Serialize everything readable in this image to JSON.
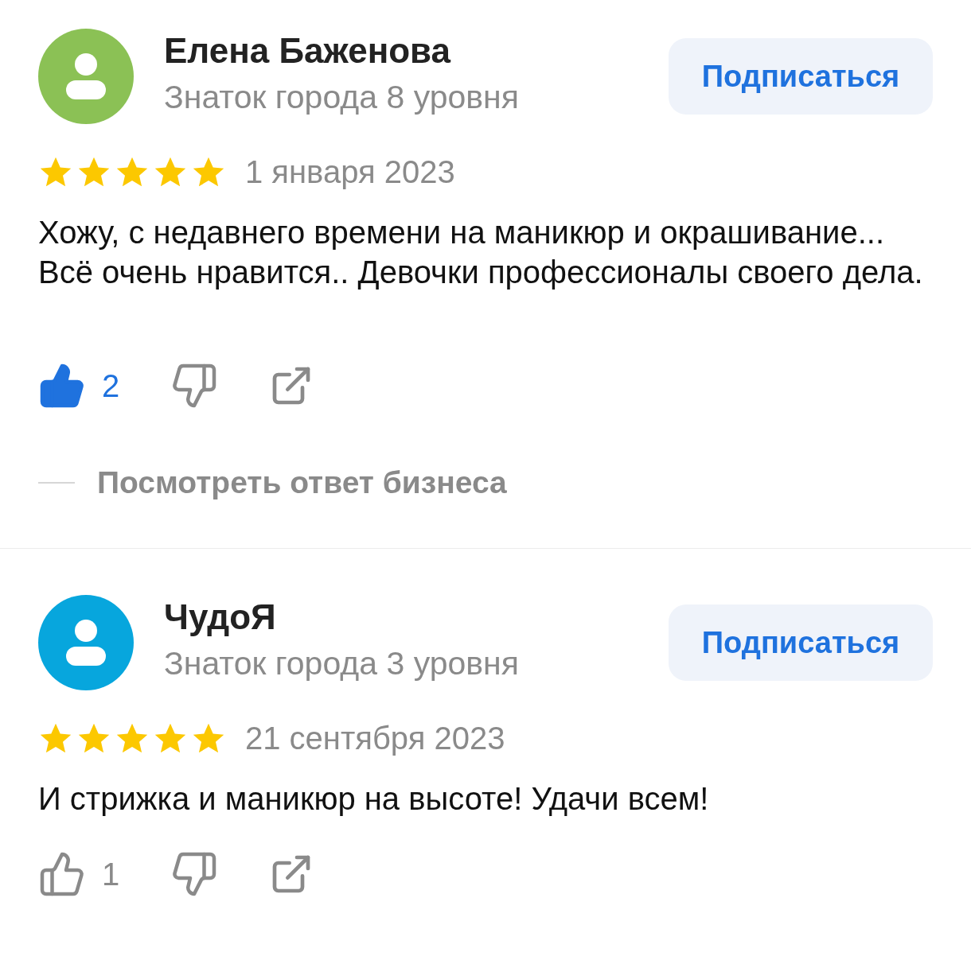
{
  "reviews": [
    {
      "author": "Елена Баженова",
      "level_text": "Знаток города 8 уровня",
      "color": "#8bc155",
      "subscribe_label": "Подписаться",
      "stars": 5,
      "date": "1 января 2023",
      "text": "Хожу, с недавнего времени на маникюр и окрашивание... Всё очень нравится.. Девочки профессионалы своего дела.",
      "likes": "2",
      "liked": true,
      "business_reply_label": "Посмотреть ответ бизнеса"
    },
    {
      "author": "ЧудоЯ",
      "level_text": "Знаток города 3 уровня",
      "color": "#07a6dd",
      "subscribe_label": "Подписаться",
      "stars": 5,
      "date": "21 сентября 2023",
      "text": "И стрижка и маникюр на высоте! Удачи всем!",
      "likes": "1",
      "liked": false
    }
  ]
}
